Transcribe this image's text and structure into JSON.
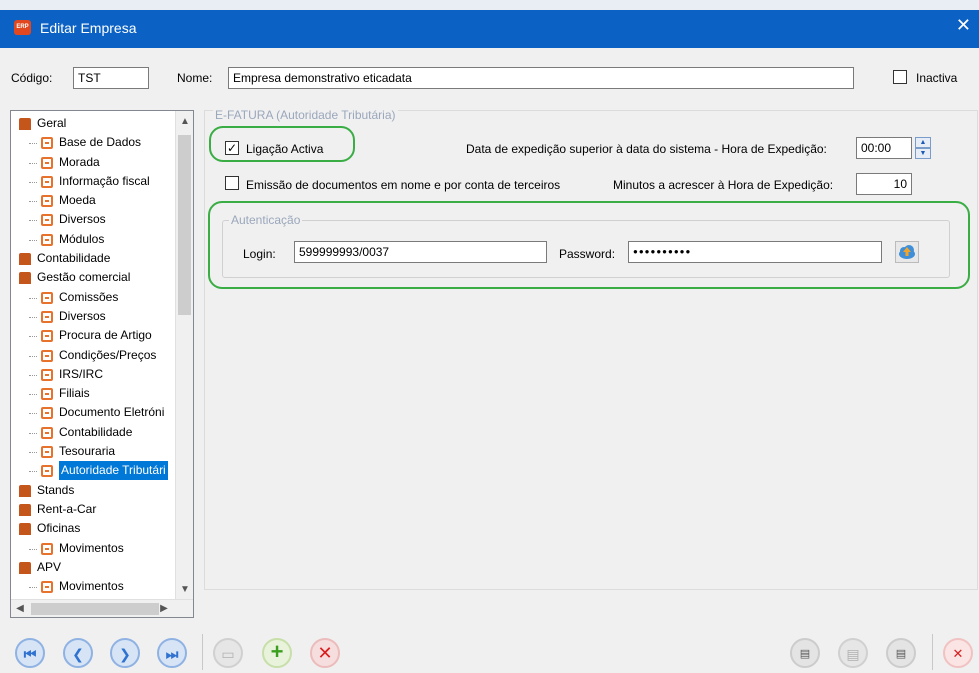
{
  "window": {
    "title": "Editar Empresa",
    "logo_text": "ERP",
    "close_glyph": "✕"
  },
  "header": {
    "codigo_label": "Código:",
    "codigo_value": "TST",
    "nome_label": "Nome:",
    "nome_value": "Empresa demonstrativo eticadata",
    "inactiva_label": "Inactiva",
    "inactiva_checked": false
  },
  "tree": {
    "items": [
      {
        "label": "Geral",
        "level": 0
      },
      {
        "label": "Base de Dados",
        "level": 1
      },
      {
        "label": "Morada",
        "level": 1
      },
      {
        "label": "Informação fiscal",
        "level": 1
      },
      {
        "label": "Moeda",
        "level": 1
      },
      {
        "label": "Diversos",
        "level": 1
      },
      {
        "label": "Módulos",
        "level": 1
      },
      {
        "label": "Contabilidade",
        "level": 0
      },
      {
        "label": "Gestão comercial",
        "level": 0
      },
      {
        "label": "Comissões",
        "level": 1
      },
      {
        "label": "Diversos",
        "level": 1
      },
      {
        "label": "Procura de Artigo",
        "level": 1
      },
      {
        "label": "Condições/Preços",
        "level": 1
      },
      {
        "label": "IRS/IRC",
        "level": 1
      },
      {
        "label": "Filiais",
        "level": 1
      },
      {
        "label": "Documento Eletróni",
        "level": 1
      },
      {
        "label": "Contabilidade",
        "level": 1
      },
      {
        "label": "Tesouraria",
        "level": 1
      },
      {
        "label": "Autoridade Tributári",
        "level": 1,
        "selected": true
      },
      {
        "label": "Stands",
        "level": 0
      },
      {
        "label": "Rent-a-Car",
        "level": 0
      },
      {
        "label": "Oficinas",
        "level": 0
      },
      {
        "label": "Movimentos",
        "level": 1
      },
      {
        "label": "APV",
        "level": 0
      },
      {
        "label": "Movimentos",
        "level": 1
      }
    ]
  },
  "efatura": {
    "group_title": "E-FATURA (Autoridade Tributária)",
    "ligacao_label": "Ligação Activa",
    "ligacao_checked": true,
    "expedicao_label": "Data de expedição superior à data do sistema - Hora de Expedição:",
    "hora_value": "00:00",
    "emissao_label": "Emissão de documentos em nome e por conta de terceiros",
    "emissao_checked": false,
    "minutos_label": "Minutos a acrescer à Hora de Expedição:",
    "minutos_value": "10",
    "auth": {
      "group_title": "Autenticação",
      "login_label": "Login:",
      "login_value": "599999993/0037",
      "password_label": "Password:",
      "password_value": "●●●●●●●●●●"
    }
  },
  "toolbar": {
    "buttons": [
      {
        "name": "first-record-button",
        "glyph": "⏮"
      },
      {
        "name": "previous-record-button",
        "glyph": "❮"
      },
      {
        "name": "next-record-button",
        "glyph": "❯"
      },
      {
        "name": "last-record-button",
        "glyph": "⏭"
      },
      {
        "name": "save-button",
        "glyph": "▭"
      },
      {
        "name": "add-button",
        "glyph": "+"
      },
      {
        "name": "delete-button",
        "glyph": "✕"
      },
      {
        "name": "export-button",
        "glyph": "▤"
      },
      {
        "name": "print-button",
        "glyph": "▤"
      },
      {
        "name": "options-button",
        "glyph": "▤"
      },
      {
        "name": "exit-button",
        "glyph": "✕"
      }
    ]
  },
  "colors": {
    "titlebar": "#0b62c4",
    "highlight": "#3aad45",
    "selection": "#0078d7"
  }
}
